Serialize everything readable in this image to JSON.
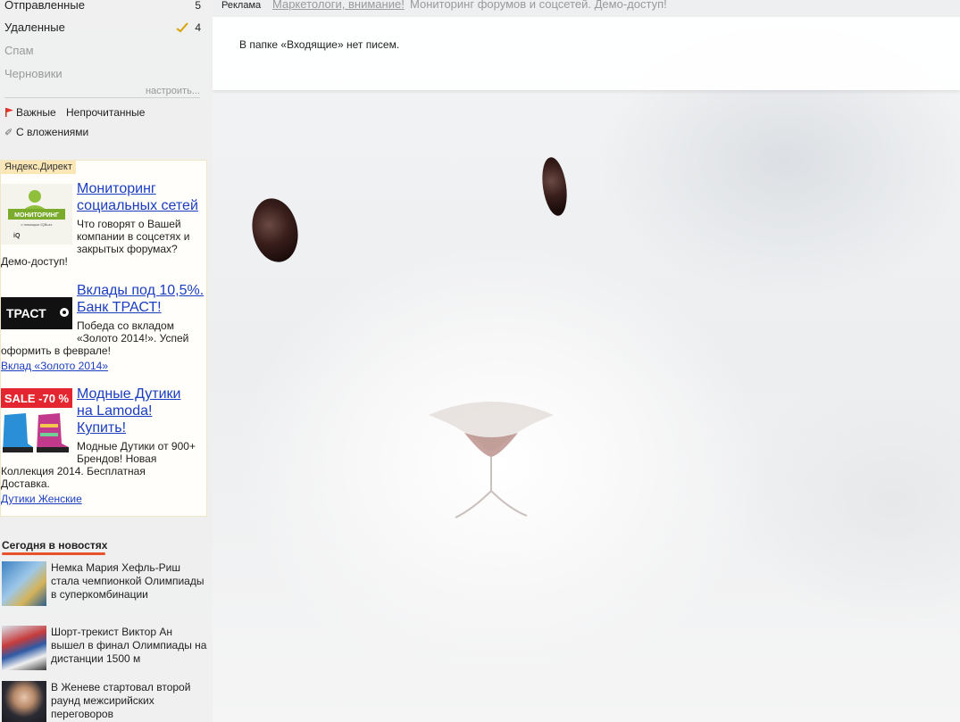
{
  "folders": [
    {
      "label": "Отправленные",
      "count": "5"
    },
    {
      "label": "Удаленные",
      "count": "4"
    },
    {
      "label": "Спам"
    },
    {
      "label": "Черновики"
    }
  ],
  "setup_link": "настроить...",
  "filters": {
    "important": "Важные",
    "unread": "Непрочитанные",
    "attachments": "С вложениями"
  },
  "direct": {
    "badge": "Яндекс.Директ",
    "ads": [
      {
        "title": "Мониторинг социальных сетей",
        "text_wrapped": "Что говорят о Вашей компании в соцсетях и закрытых форумах?",
        "text_tail": "Демо-доступ!",
        "link": "",
        "image_label": "МОНИТОРИНГ",
        "image_sub": "с помощью IQBuzz"
      },
      {
        "title": "Вклады под 10,5%. Банк ТРАСТ!",
        "text_wrapped": "Победа со вкладом «Золото 2014!». Успей",
        "text_tail": "оформить в феврале!",
        "link": "Вклад «Золото 2014»",
        "image_label": "ТРАСТ"
      },
      {
        "title": "Модные Дутики на Lamoda! Купить!",
        "text_wrapped": "Модные Дутики от 900+ Брендов! Новая",
        "text_tail": "Коллекция 2014. Бесплатная Доставка.",
        "link": "Дутики Женские",
        "image_label": "SALE -70 %"
      }
    ]
  },
  "news": {
    "title": "Сегодня в новостях",
    "items": [
      {
        "text": "Немка Мария Хефль-Риш стала чемпионкой Олимпиады в суперкомбинации"
      },
      {
        "text": "Шорт-трекист Виктор Ан вышел в финал Олимпиады на дистанции 1500 м"
      },
      {
        "text": "В Женеве стартовал второй раунд межсирийских переговоров"
      }
    ]
  },
  "top_ad": {
    "label": "Реклама",
    "link": "Маркетологи, внимание!",
    "text": "Мониторинг форумов и соцсетей. Демо-доступ!"
  },
  "main": {
    "empty_message": "В папке «Входящие» нет писем."
  },
  "colors": {
    "link": "#1a3dc1",
    "news_accent": "#e8532d",
    "direct_badge": "#fbe7b6"
  }
}
